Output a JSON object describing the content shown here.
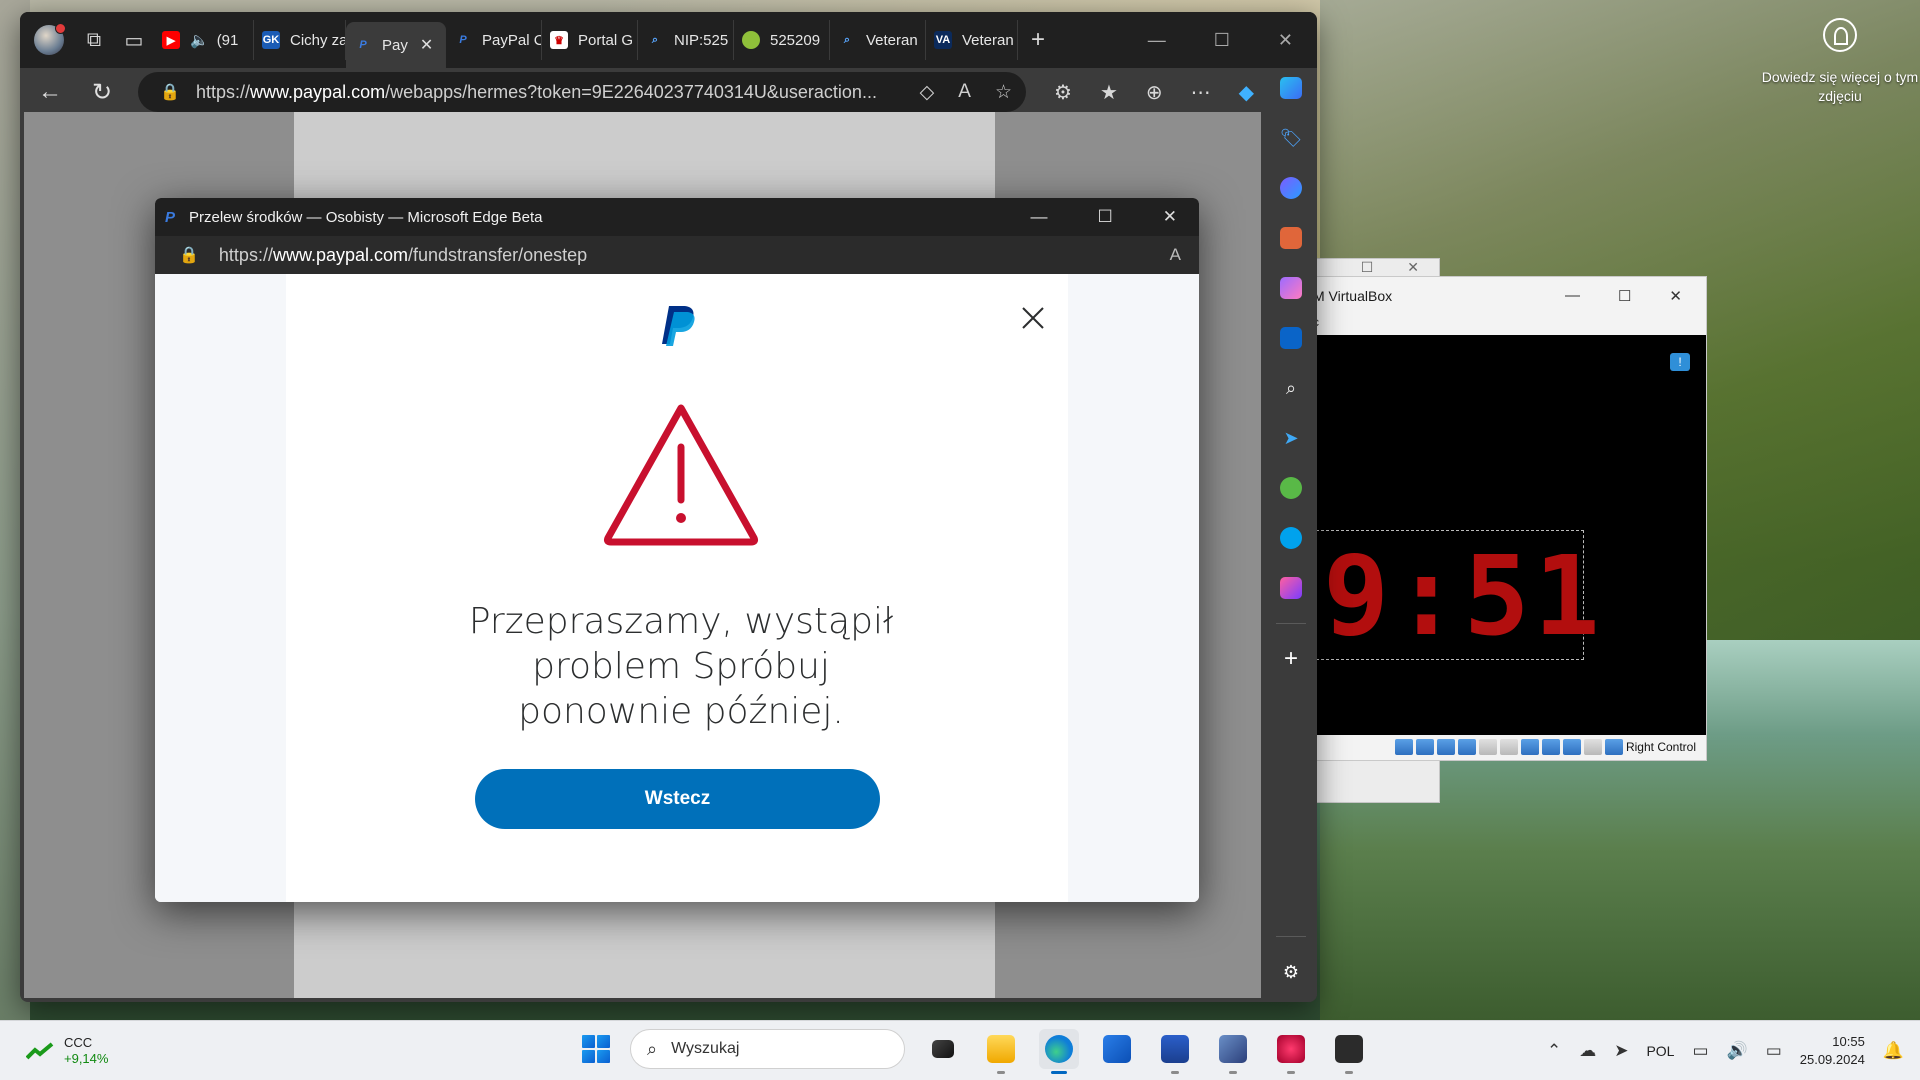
{
  "desktop": {
    "learn_more": "Dowiedz się więcej o tym zdjęciu"
  },
  "edge": {
    "tabs": [
      {
        "label": "",
        "icon": "youtube-icon",
        "extra": "(91"
      },
      {
        "label": "Cichy za",
        "icon": "gk-icon"
      },
      {
        "label": "Pay",
        "icon": "paypal-icon",
        "active": true
      },
      {
        "label": "PayPal C",
        "icon": "paypal-icon"
      },
      {
        "label": "Portal G",
        "icon": "gov-icon"
      },
      {
        "label": "NIP:525",
        "icon": "search-icon"
      },
      {
        "label": "525209",
        "icon": "green-icon"
      },
      {
        "label": "Veteran",
        "icon": "search-icon"
      },
      {
        "label": "Veteran",
        "icon": "va-icon"
      }
    ],
    "address": {
      "scheme": "https://",
      "host": "www.paypal.com",
      "path": "/webapps/hermes?token=9E22640237740314U&useraction..."
    }
  },
  "popup": {
    "title": "Przelew środków — Osobisty — Microsoft Edge Beta",
    "address": {
      "scheme": "https://",
      "host": "www.paypal.com",
      "path": "/fundstransfer/onestep"
    },
    "message": "Przepraszamy, wystąpił problem Spróbuj ponownie później.",
    "button_label": "Wstecz"
  },
  "vbox": {
    "title": "M VirtualBox",
    "menu": "c",
    "clock_text": "9:51",
    "status_label": "Right Control"
  },
  "taskbar": {
    "widget_name": "CCC",
    "widget_change": "+9,14%",
    "search_placeholder": "Wyszukaj",
    "language": "POL",
    "time": "10:55",
    "date": "25.09.2024"
  },
  "colors": {
    "paypal_blue": "#0070ba",
    "warning_red": "#c8102e",
    "clock_red": "#b20e0e"
  }
}
